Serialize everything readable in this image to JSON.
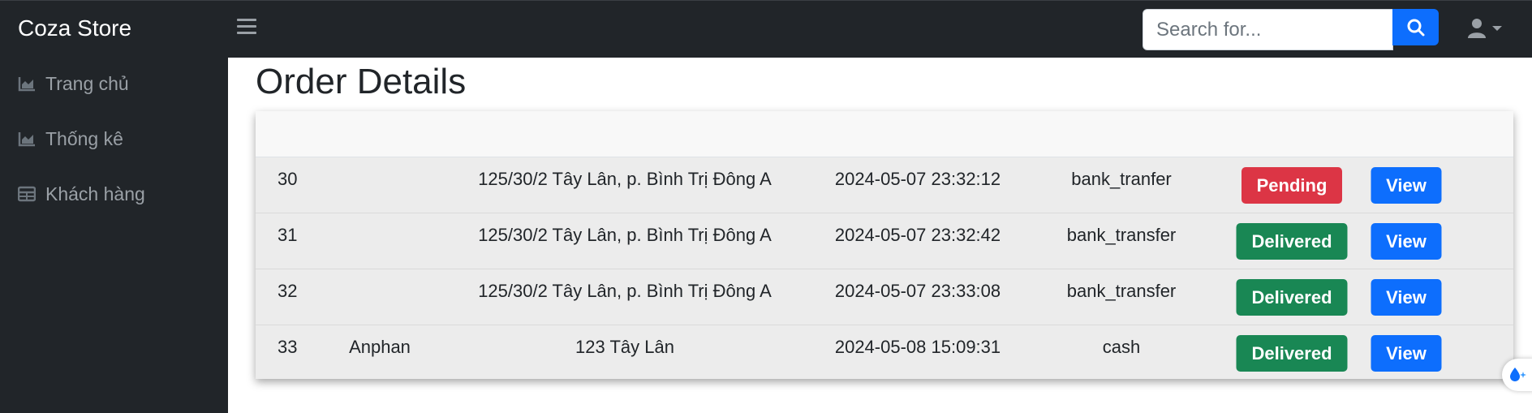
{
  "brand": "Coza Store",
  "search": {
    "placeholder": "Search for..."
  },
  "sidebar": {
    "items": [
      {
        "label": "Trang chủ",
        "icon": "chart-area-icon"
      },
      {
        "label": "Thống kê",
        "icon": "chart-area-icon"
      },
      {
        "label": "Khách hàng",
        "icon": "table-icon"
      }
    ]
  },
  "page": {
    "title": "Order Details"
  },
  "orders": {
    "view_label": "View",
    "rows": [
      {
        "id": "30",
        "name": "",
        "address": "125/30/2 Tây Lân, p. Bình Trị Đông A",
        "date": "2024-05-07 23:32:12",
        "payment": "bank_tranfer",
        "status": "Pending"
      },
      {
        "id": "31",
        "name": "",
        "address": "125/30/2 Tây Lân, p. Bình Trị Đông A",
        "date": "2024-05-07 23:32:42",
        "payment": "bank_transfer",
        "status": "Delivered"
      },
      {
        "id": "32",
        "name": "",
        "address": "125/30/2 Tây Lân, p. Bình Trị Đông A",
        "date": "2024-05-07 23:33:08",
        "payment": "bank_transfer",
        "status": "Delivered"
      },
      {
        "id": "33",
        "name": "Anphan",
        "address": "123 Tây Lân",
        "date": "2024-05-08 15:09:31",
        "payment": "cash",
        "status": "Delivered"
      }
    ]
  },
  "colors": {
    "navbar": "#212529",
    "primary": "#0d6efd",
    "danger": "#dc3545",
    "success": "#198754"
  }
}
